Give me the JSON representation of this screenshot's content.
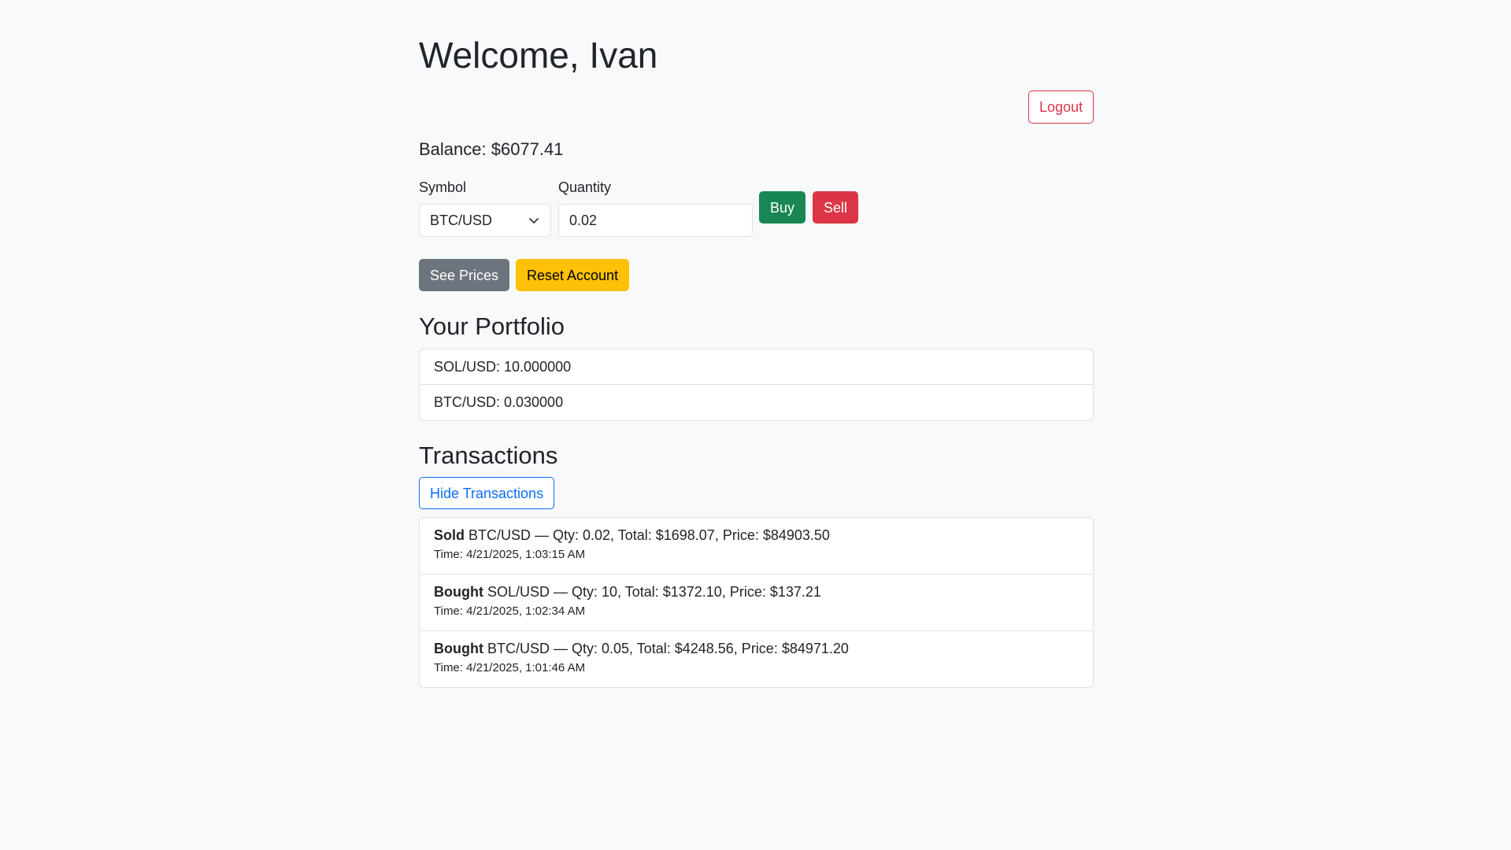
{
  "header": {
    "title": "Welcome, Ivan",
    "logout_label": "Logout"
  },
  "account": {
    "balance_text": "Balance: $6077.41"
  },
  "trade_form": {
    "symbol_label": "Symbol",
    "symbol_value": "BTC/USD",
    "quantity_label": "Quantity",
    "quantity_value": "0.02",
    "buy_label": "Buy",
    "sell_label": "Sell"
  },
  "actions": {
    "see_prices_label": "See Prices",
    "reset_account_label": "Reset Account"
  },
  "portfolio": {
    "title": "Your Portfolio",
    "items": [
      {
        "text": "SOL/USD: 10.000000"
      },
      {
        "text": "BTC/USD: 0.030000"
      }
    ]
  },
  "transactions": {
    "title": "Transactions",
    "toggle_label": "Hide Transactions",
    "items": [
      {
        "action": "Sold",
        "details": " BTC/USD — Qty: 0.02, Total: $1698.07, Price: $84903.50",
        "time": "Time: 4/21/2025, 1:03:15 AM"
      },
      {
        "action": "Bought",
        "details": " SOL/USD — Qty: 10, Total: $1372.10, Price: $137.21",
        "time": "Time: 4/21/2025, 1:02:34 AM"
      },
      {
        "action": "Bought",
        "details": " BTC/USD — Qty: 0.05, Total: $4248.56, Price: $84971.20",
        "time": "Time: 4/21/2025, 1:01:46 AM"
      }
    ]
  },
  "colors": {
    "background": "#f8f9fa",
    "success": "#198754",
    "danger": "#dc3545",
    "secondary": "#6c757d",
    "warning": "#ffc107",
    "primary": "#0d6efd"
  },
  "icons": {
    "select_arrow": "chevron-down-icon"
  }
}
